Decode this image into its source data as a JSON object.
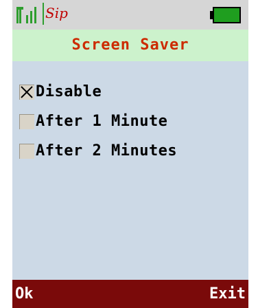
{
  "status": {
    "signal_icon": "signal-strength-icon",
    "logo_text": "Sip",
    "battery_icon": "battery-full-icon",
    "colors": {
      "signal": "#2e9e2e",
      "logo": "#c00000",
      "battery": "#1f9e1f"
    }
  },
  "header": {
    "title": "Screen Saver"
  },
  "options": [
    {
      "label": "Disable",
      "checked": true
    },
    {
      "label": "After 1 Minute",
      "checked": false
    },
    {
      "label": "After 2 Minutes",
      "checked": false
    }
  ],
  "softkeys": {
    "left": "Ok",
    "right": "Exit"
  },
  "colors": {
    "background": "#ccd9e6",
    "title_bar": "#ccf2cc",
    "title_text": "#cc2a00",
    "softkey_bar": "#7a0a0a"
  }
}
